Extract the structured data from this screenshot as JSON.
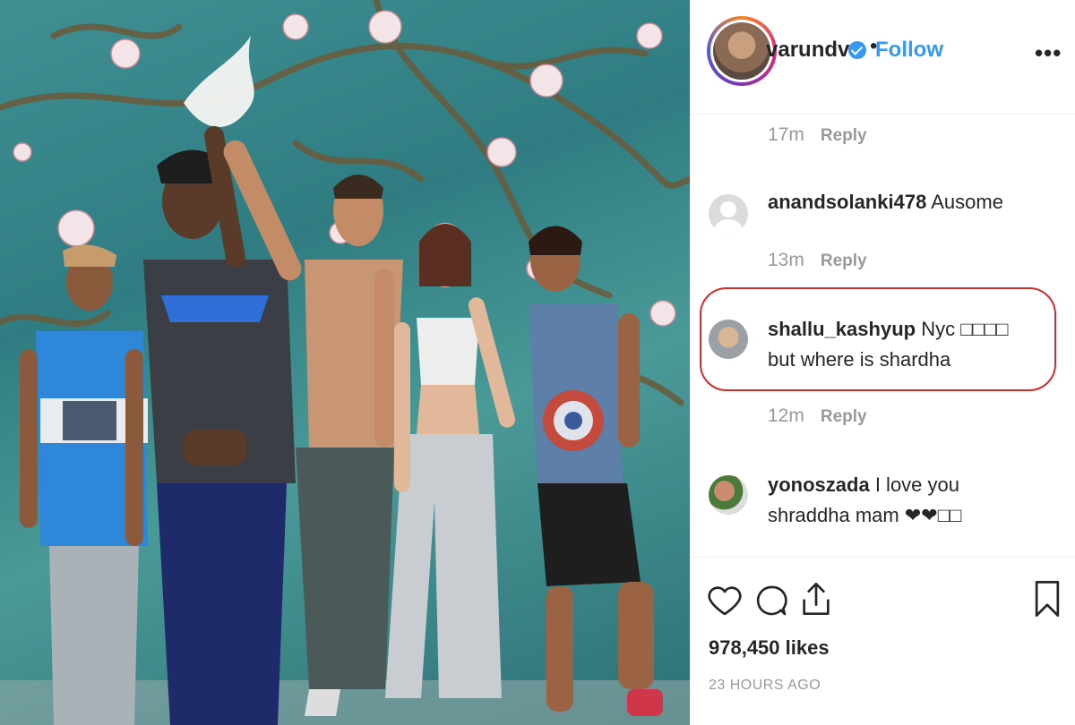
{
  "post": {
    "username": "varundvn",
    "follow_label": "Follow",
    "dot": "•",
    "more_label": "•••"
  },
  "comments": [
    {
      "meta_time": "17m",
      "reply_label": "Reply"
    },
    {
      "user": "anandsolanki478",
      "text": "Ausome",
      "time": "13m",
      "reply_label": "Reply",
      "avatar": "default-avatar"
    },
    {
      "user": "shallu_kashyup",
      "text": "Nyc □□□□ but where is shardha",
      "time": "12m",
      "reply_label": "Reply",
      "avatar": "user-photo",
      "highlighted": true
    },
    {
      "user": "yonoszada",
      "text": "I love you shraddha mam ❤❤□□",
      "avatar": "user-photo"
    }
  ],
  "actions": {
    "likes": "978,450 likes",
    "time_ago": "23 HOURS AGO",
    "icons": [
      "heart-icon",
      "comment-icon",
      "share-icon",
      "bookmark-icon"
    ]
  },
  "colors": {
    "accent": "#3897f0",
    "highlight": "#d22b2b",
    "muted": "#999999",
    "text": "#262626"
  }
}
